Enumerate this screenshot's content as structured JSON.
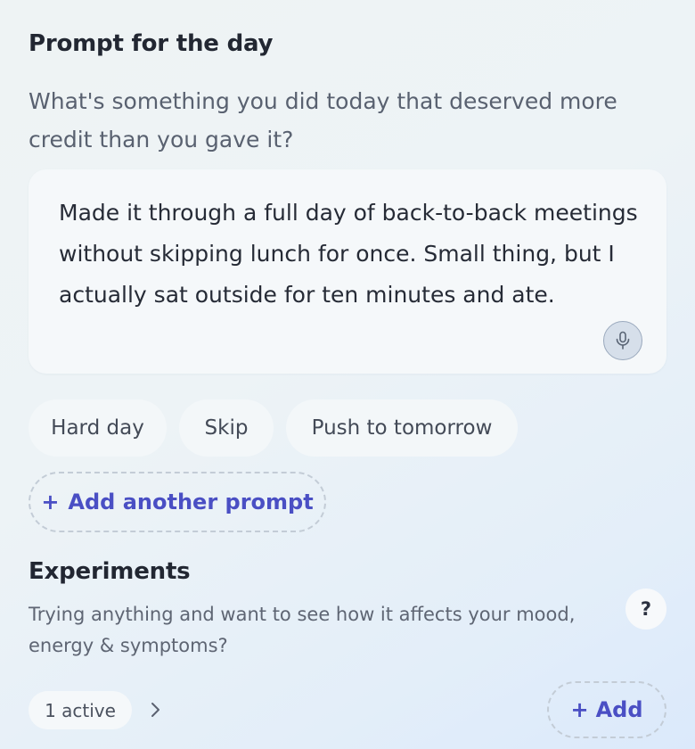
{
  "prompt_section": {
    "title": "Prompt for the day",
    "question": "What's something you did today that deserved more credit than you gave it?",
    "answer": "Made it through a full day of back-to-back meetings without skipping lunch for once. Small thing, but I actually sat outside for ten minutes and ate.",
    "chips": [
      {
        "label": "Hard day"
      },
      {
        "label": "Skip"
      },
      {
        "label": "Push to tomorrow"
      }
    ],
    "add_prompt_plus": "+",
    "add_prompt_label": "Add another prompt"
  },
  "experiments": {
    "title": "Experiments",
    "description": "Trying anything and want to see how it affects your mood, energy & symptoms?",
    "help_label": "?",
    "active_label": "1 active",
    "add_plus": "+",
    "add_label": "Add"
  },
  "colors": {
    "accent": "#4a4fc4",
    "heading": "#222732",
    "muted": "#596170",
    "card": "#f5f8fa"
  },
  "icons": [
    "microphone-icon",
    "chevron-right-icon"
  ]
}
